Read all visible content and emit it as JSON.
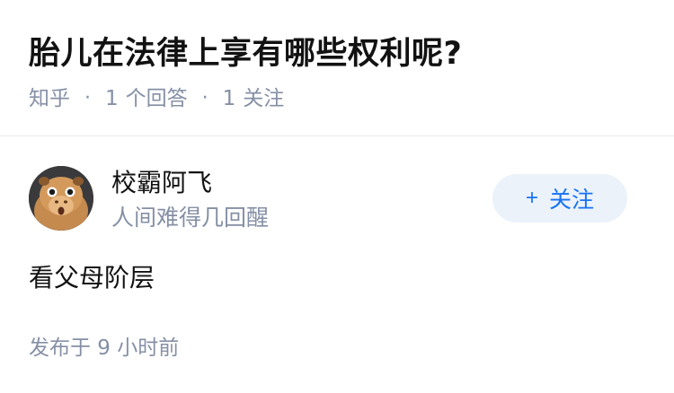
{
  "question": {
    "title": "胎儿在法律上享有哪些权利呢?",
    "source": "知乎",
    "answer_count": "1",
    "answer_label": "个回答",
    "follower_count": "1",
    "follower_label": "关注"
  },
  "answer": {
    "author": {
      "name": "校霸阿飞",
      "bio": "人间难得几回醒",
      "avatar_icon": "capybara-avatar"
    },
    "follow_button": {
      "plus": "+",
      "label": "关注"
    },
    "content": "看父母阶层",
    "published": "发布于 9 小时前"
  },
  "colors": {
    "title": "#121212",
    "meta": "#8590a6",
    "follow_bg": "#ebf2fa",
    "follow_text": "#1772f6",
    "divider": "#ebebeb"
  }
}
